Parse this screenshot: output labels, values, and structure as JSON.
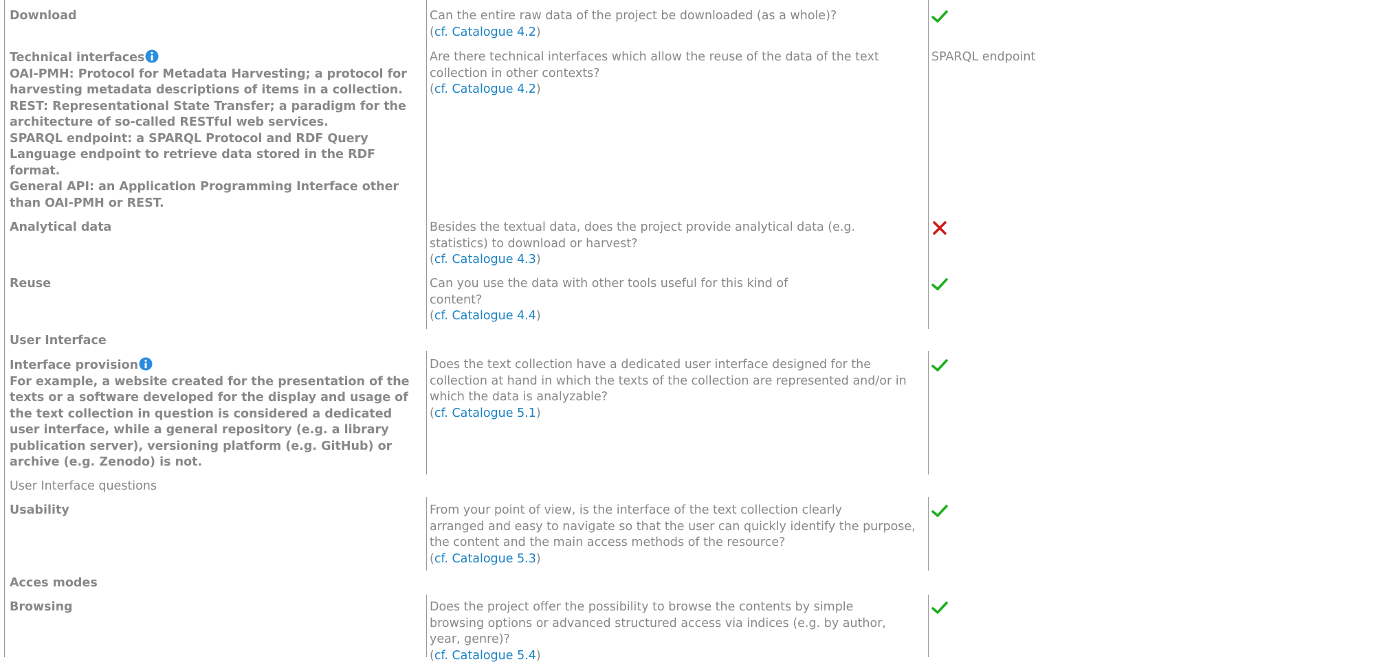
{
  "colors": {
    "text": "#888888",
    "link": "#1a82c4",
    "check": "#1fae1f",
    "cross": "#d01818",
    "info": "#2a8de0",
    "rule": "#9a9a9a"
  },
  "rows": {
    "download": {
      "label": "Download",
      "question": "Can the entire raw data of the project be downloaded (as a whole)?",
      "ref_open": "(",
      "ref_link": "cf. Catalogue 4.2",
      "ref_close": ")",
      "answer_icon": "check-icon"
    },
    "technical": {
      "label": "Technical interfaces",
      "info_lines": [
        "OAI-PMH: Protocol for Metadata Harvesting; a protocol for",
        "harvesting metadata descriptions of items in a collection.",
        "REST: Representational State Transfer; a paradigm for the",
        "architecture of so-called RESTful web services.",
        "SPARQL endpoint: a SPARQL Protocol and RDF Query",
        "Language endpoint to retrieve data stored in the RDF",
        "format.",
        "General API: an Application Programming Interface other",
        "than OAI-PMH or REST."
      ],
      "question_lines": [
        "Are there technical interfaces which allow the reuse of the data of the text",
        "collection in other contexts?"
      ],
      "ref_open": "(",
      "ref_link": "cf. Catalogue 4.2",
      "ref_close": ")",
      "answer_text": "SPARQL endpoint"
    },
    "analytical": {
      "label": "Analytical data",
      "question_lines": [
        "Besides the textual data, does the project provide analytical data (e.g.",
        "statistics) to download or harvest?"
      ],
      "ref_open": "(",
      "ref_link": "cf. Catalogue 4.3",
      "ref_close": ")",
      "answer_icon": "cross-icon"
    },
    "reuse": {
      "label": "Reuse",
      "question_lines": [
        "Can you use the data with other tools useful for this kind of",
        "content?"
      ],
      "ref_open": "(",
      "ref_link": "cf. Catalogue 4.4",
      "ref_close": ")",
      "answer_icon": "check-icon"
    },
    "interface_provision": {
      "label": "Interface provision",
      "info_lines": [
        "For example, a website created for the presentation of the",
        "texts or a software developed for the display and usage of",
        "the text collection in question is considered a dedicated",
        "user interface, while a general repository (e.g. a library",
        "publication server), versioning platform (e.g. GitHub) or",
        "archive (e.g. Zenodo) is not."
      ],
      "question_lines": [
        "Does the text collection have a dedicated user interface designed for the",
        "collection at hand in which the texts of the collection are represented and/or in",
        "which the data is analyzable?"
      ],
      "ref_open": "(",
      "ref_link": "cf. Catalogue 5.1",
      "ref_close": ")",
      "answer_icon": "check-icon"
    },
    "usability": {
      "label": "Usability",
      "question_lines": [
        "From your point of view, is the interface of the text collection clearly",
        "arranged and easy to navigate so that the user can quickly identify the purpose,",
        "the content and the main access methods of the resource?"
      ],
      "ref_open": "(",
      "ref_link": "cf. Catalogue 5.3",
      "ref_close": ")",
      "answer_icon": "check-icon"
    },
    "browsing": {
      "label": "Browsing",
      "question_lines": [
        "Does the project offer the possibility to browse the contents by simple",
        "browsing options or advanced structured access via indices (e.g. by author,",
        "year, genre)?"
      ],
      "ref_open": "(",
      "ref_link": "cf. Catalogue 5.4",
      "ref_close": ")",
      "answer_icon": "check-icon"
    }
  },
  "sections": {
    "user_interface": "User Interface",
    "user_interface_questions": "User Interface questions",
    "access_modes": "Acces modes"
  }
}
